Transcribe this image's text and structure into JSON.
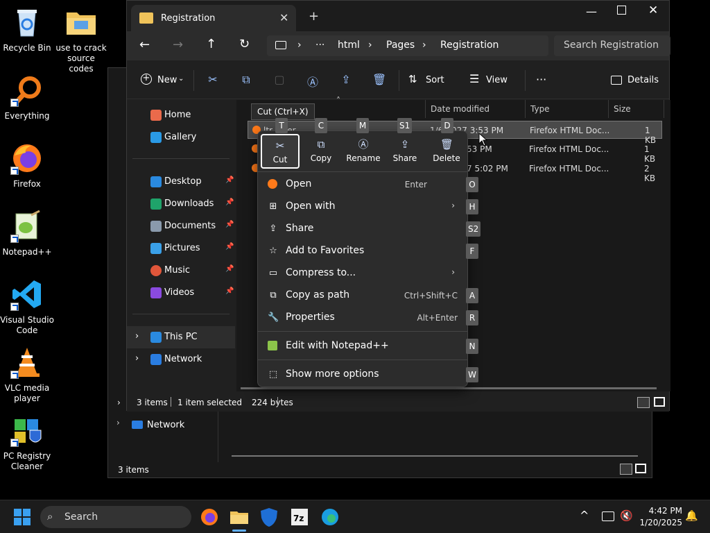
{
  "desktop": {
    "icons": [
      {
        "label": "Recycle Bin",
        "icon": "recycle-bin-icon"
      },
      {
        "label": "use to crack source codes",
        "icon": "folder-icon"
      },
      {
        "label": "Everything",
        "icon": "search-magnifier-icon"
      },
      {
        "label": "Firefox",
        "icon": "firefox-icon"
      },
      {
        "label": "Notepad++",
        "icon": "notepad-plus-plus-icon"
      },
      {
        "label": "Visual Studio Code",
        "icon": "vscode-icon"
      },
      {
        "label": "VLC media player",
        "icon": "vlc-icon"
      },
      {
        "label": "PC Registry Cleaner",
        "icon": "registry-cleaner-icon"
      }
    ]
  },
  "background_window": {
    "nav_network": "Network",
    "status": "3 items"
  },
  "explorer": {
    "tab_title": "Registration",
    "breadcrumb": [
      "html",
      "Pages",
      "Registration"
    ],
    "breadcrumb_more": "···",
    "search_placeholder": "Search Registration",
    "toolbar": {
      "new": "New",
      "sort": "Sort",
      "view": "View",
      "more": "···",
      "details": "Details"
    },
    "nav": {
      "home": "Home",
      "gallery": "Gallery",
      "desktop": "Desktop",
      "downloads": "Downloads",
      "documents": "Documents",
      "pictures": "Pictures",
      "music": "Music",
      "videos": "Videos",
      "this_pc": "This PC",
      "network": "Network"
    },
    "columns": {
      "date_modified": "Date modified",
      "type": "Type",
      "size": "Size"
    },
    "files": [
      {
        "name": "ltr...ster",
        "date": "1/6/2027 3:53 PM",
        "type": "Firefox HTML Doc...",
        "size": "1 KB"
      },
      {
        "name": "",
        "date": "53 PM",
        "type": "Firefox HTML Doc...",
        "size": "1 KB"
      },
      {
        "name": "",
        "date": "7 5:02 PM",
        "type": "Firefox HTML Doc...",
        "size": "2 KB"
      }
    ],
    "status": {
      "items": "3 items",
      "selected": "1 item selected",
      "bytes": "224 bytes"
    }
  },
  "tooltip": "Cut (Ctrl+X)",
  "context_menu": {
    "quick_actions": [
      {
        "label": "Cut",
        "icon": "scissors-icon"
      },
      {
        "label": "Copy",
        "icon": "copy-icon"
      },
      {
        "label": "Rename",
        "icon": "rename-icon"
      },
      {
        "label": "Share",
        "icon": "share-icon"
      },
      {
        "label": "Delete",
        "icon": "trash-icon"
      }
    ],
    "quick_keys": [
      "T",
      "C",
      "M",
      "S1",
      "D"
    ],
    "items": [
      {
        "label": "Open",
        "shortcut": "Enter",
        "key": "O"
      },
      {
        "label": "Open with",
        "shortcut": "",
        "key": "H"
      },
      {
        "label": "Share",
        "shortcut": "",
        "key": "S2"
      },
      {
        "label": "Add to Favorites",
        "shortcut": "",
        "key": "F"
      },
      {
        "label": "Compress to...",
        "shortcut": "",
        "key": ""
      },
      {
        "label": "Copy as path",
        "shortcut": "Ctrl+Shift+C",
        "key": "A"
      },
      {
        "label": "Properties",
        "shortcut": "Alt+Enter",
        "key": "R"
      },
      {
        "label": "Edit with Notepad++",
        "shortcut": "",
        "key": "N"
      },
      {
        "label": "Show more options",
        "shortcut": "",
        "key": "W"
      }
    ]
  },
  "taskbar": {
    "search": "Search",
    "time": "4:42 PM",
    "date": "1/20/2025",
    "apps": [
      "start-icon",
      "firefox-icon",
      "file-explorer-icon",
      "defender-icon",
      "7zip-icon",
      "edge-icon"
    ]
  }
}
